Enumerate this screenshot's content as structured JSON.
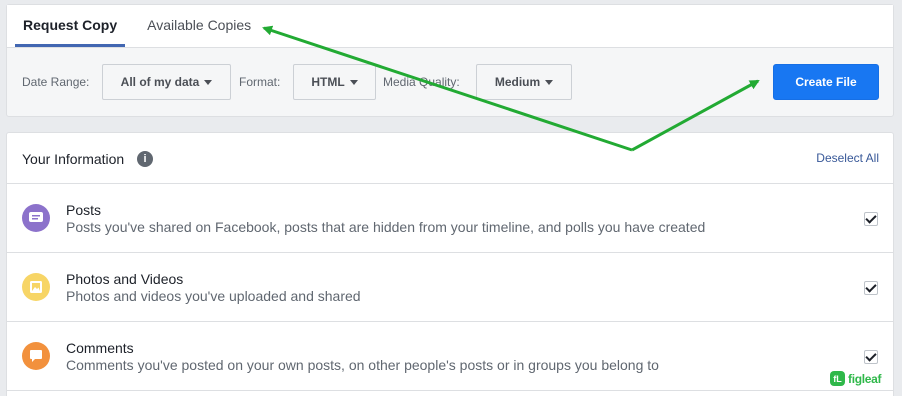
{
  "tabs": [
    {
      "label": "Request Copy",
      "active": true
    },
    {
      "label": "Available Copies",
      "active": false
    }
  ],
  "controls": {
    "date_range_label": "Date Range:",
    "date_range_value": "All of my data",
    "format_label": "Format:",
    "format_value": "HTML",
    "media_quality_label": "Media Quality:",
    "media_quality_value": "Medium",
    "create_button": "Create File"
  },
  "info": {
    "title": "Your Information",
    "info_glyph": "i",
    "deselect_all": "Deselect All",
    "items": [
      {
        "title": "Posts",
        "description": "Posts you've shared on Facebook, posts that are hidden from your timeline, and polls you have created",
        "icon": "posts-icon",
        "color": "#8c72cb",
        "checked": true
      },
      {
        "title": "Photos and Videos",
        "description": "Photos and videos you've uploaded and shared",
        "icon": "photos-icon",
        "color": "#f7d566",
        "checked": true
      },
      {
        "title": "Comments",
        "description": "Comments you've posted on your own posts, on other people's posts or in groups you belong to",
        "icon": "comments-icon",
        "color": "#f2913d",
        "checked": true
      }
    ]
  },
  "watermark": {
    "mark": "fL",
    "text": "figleaf",
    "color": "#2fb84a"
  },
  "colors": {
    "accent": "#1877f2",
    "tab_underline": "#4267b2",
    "link": "#385898",
    "annotation": "#22aa33"
  }
}
